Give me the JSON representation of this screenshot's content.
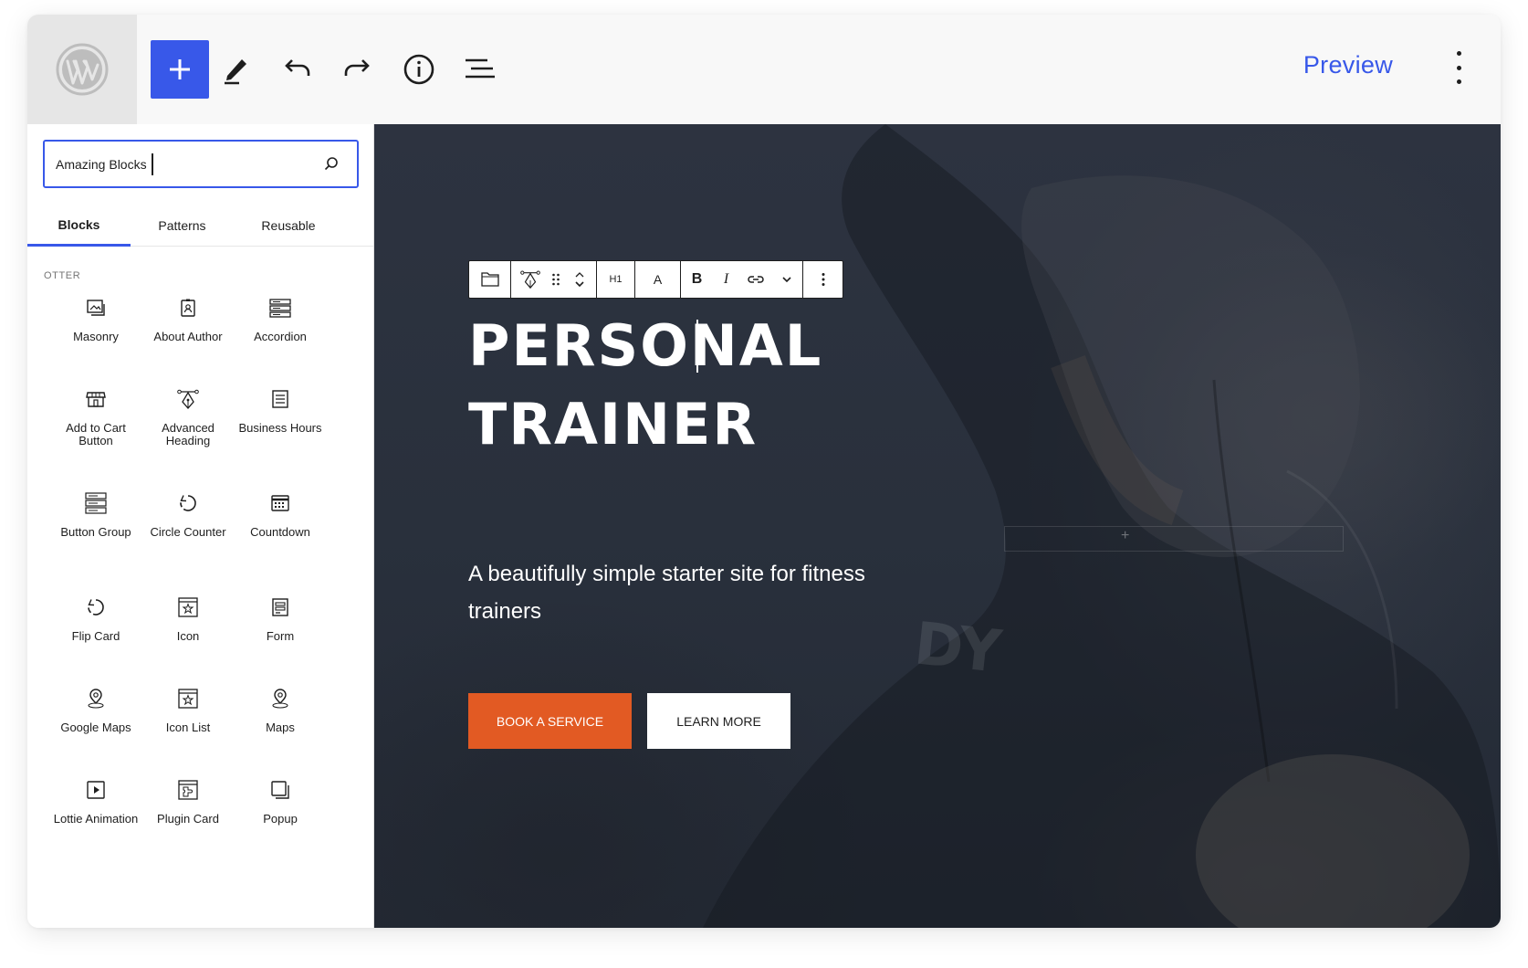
{
  "toolbar": {
    "logo_icon": "wordpress-logo",
    "preview_label": "Preview",
    "accent_color": "#3858e9"
  },
  "sidebar": {
    "search": {
      "value": "Amazing Blocks",
      "placeholder": "Search"
    },
    "tabs": [
      {
        "label": "Blocks",
        "active": true
      },
      {
        "label": "Patterns",
        "active": false
      },
      {
        "label": "Reusable",
        "active": false
      }
    ],
    "category": "OTTER",
    "blocks": [
      {
        "label": "Masonry",
        "icon": "masonry-icon"
      },
      {
        "label": "About Author",
        "icon": "about-author-icon"
      },
      {
        "label": "Accordion",
        "icon": "accordion-icon"
      },
      {
        "label": "Add to Cart Button",
        "icon": "storefront-icon"
      },
      {
        "label": "Advanced Heading",
        "icon": "pen-nib-icon"
      },
      {
        "label": "Business Hours",
        "icon": "list-document-icon"
      },
      {
        "label": "Button Group",
        "icon": "button-group-icon"
      },
      {
        "label": "Circle Counter",
        "icon": "circle-counter-icon"
      },
      {
        "label": "Countdown",
        "icon": "calendar-icon"
      },
      {
        "label": "Flip Card",
        "icon": "flip-card-icon"
      },
      {
        "label": "Icon",
        "icon": "icon-picker-icon"
      },
      {
        "label": "Form",
        "icon": "form-icon"
      },
      {
        "label": "Google Maps",
        "icon": "map-pin-icon"
      },
      {
        "label": "Icon List",
        "icon": "icon-list-icon"
      },
      {
        "label": "Maps",
        "icon": "map-pin-icon"
      },
      {
        "label": "Lottie Animation",
        "icon": "play-icon"
      },
      {
        "label": "Plugin Card",
        "icon": "plugin-card-icon"
      },
      {
        "label": "Popup",
        "icon": "popup-icon"
      }
    ]
  },
  "block_toolbar": {
    "heading_level": "H1",
    "text_color_label": "A",
    "bold_label": "B",
    "italic_label": "I"
  },
  "hero": {
    "title_line1": "PERSONAL",
    "title_line2": "TRAINER",
    "subtitle": "A beautifully simple starter site for fitness trainers",
    "primary_button": "BOOK A SERVICE",
    "secondary_button": "LEARN MORE",
    "primary_color": "#e25a23"
  }
}
